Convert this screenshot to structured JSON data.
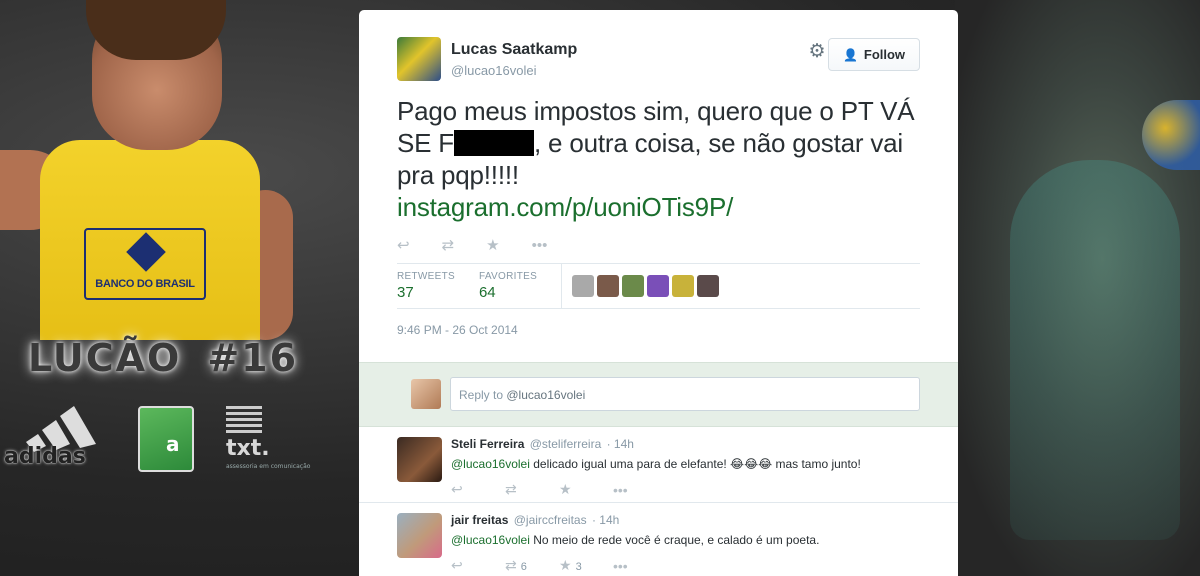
{
  "branding": {
    "sponsor": "BANCO DO BRASIL",
    "player_name": "LUCÃO",
    "number": "#16",
    "brand1": "adidas",
    "brand2": "a",
    "brand3_main": "txt.",
    "brand3_sub": "assessoria em comunicação"
  },
  "tweet": {
    "author_name": "Lucas Saatkamp",
    "author_handle": "@lucao16volei",
    "follow_label": "Follow",
    "text_before": "Pago meus impostos sim, quero que o PT VÁ SE F",
    "text_after": ", e outra coisa, se não gostar vai pra pqp!!!!!",
    "link": "instagram.com/p/uoniOTis9P/",
    "retweets_label": "RETWEETS",
    "retweets": "37",
    "favorites_label": "FAVORITES",
    "favorites": "64",
    "timestamp": "9:46 PM - 26 Oct 2014",
    "fav_avatar_colors": [
      "#a9a9a9",
      "#7a5a4a",
      "#6b8a4a",
      "#7a4fb8",
      "#c8b23a",
      "#5a4a4a"
    ]
  },
  "reply_box": {
    "placeholder_prefix": "Reply to ",
    "handle": "@lucao16volei"
  },
  "replies": [
    {
      "name": "Steli Ferreira",
      "handle": "@steliferreira",
      "time": "· 14h",
      "mention": "@lucao16volei",
      "text": " delicado igual uma para de elefante! 😂😂😂 mas tamo junto!",
      "retweets": "",
      "favorites": ""
    },
    {
      "name": "jair freitas",
      "handle": "@jairccfreitas",
      "time": "· 14h",
      "mention": "@lucao16volei",
      "text": " No meio de rede você é craque, e calado é um poeta.",
      "retweets": "6",
      "favorites": "3"
    }
  ],
  "icons": {
    "reply": "↩",
    "retweet": "⇄",
    "favorite": "★",
    "more": "•••",
    "gear": "⚙",
    "follow": "👤+"
  }
}
